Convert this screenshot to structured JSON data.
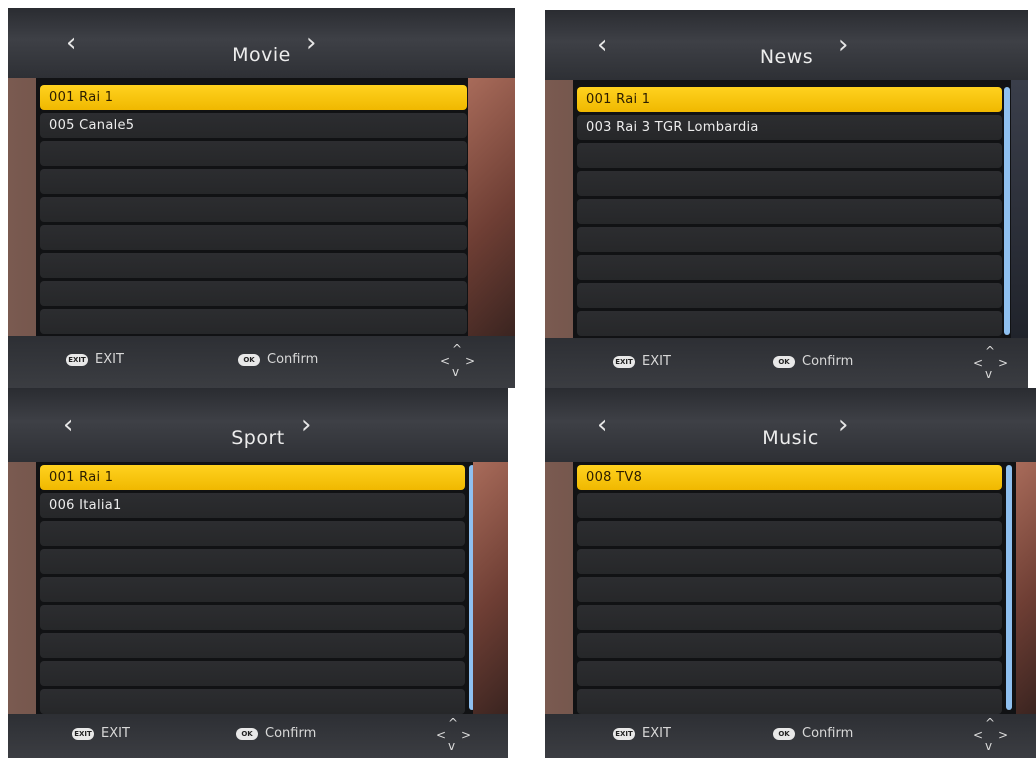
{
  "nav": {
    "prev_glyph": "‹",
    "next_glyph": "›"
  },
  "footer": {
    "exit_key": "EXIT",
    "exit_label": "EXIT",
    "ok_key": "OK",
    "confirm_label": "Confirm",
    "dpad": {
      "up": "^",
      "down": "v",
      "left": "<",
      "right": ">"
    }
  },
  "panels": [
    {
      "title": "Movie",
      "channels": [
        "001 Rai 1",
        "005 Canale5",
        "",
        "",
        "",
        "",
        "",
        "",
        ""
      ]
    },
    {
      "title": "News",
      "channels": [
        "001 Rai 1",
        "003 Rai 3 TGR Lombardia",
        "",
        "",
        "",
        "",
        "",
        "",
        ""
      ]
    },
    {
      "title": "Sport",
      "channels": [
        "001 Rai 1",
        "006 Italia1",
        "",
        "",
        "",
        "",
        "",
        "",
        ""
      ]
    },
    {
      "title": "Music",
      "channels": [
        "008 TV8",
        "",
        "",
        "",
        "",
        "",
        "",
        "",
        ""
      ]
    }
  ],
  "colors": {
    "selected_row": "#ffc800",
    "scrollbar": "#8fc0f0",
    "header": "#3e4046"
  }
}
